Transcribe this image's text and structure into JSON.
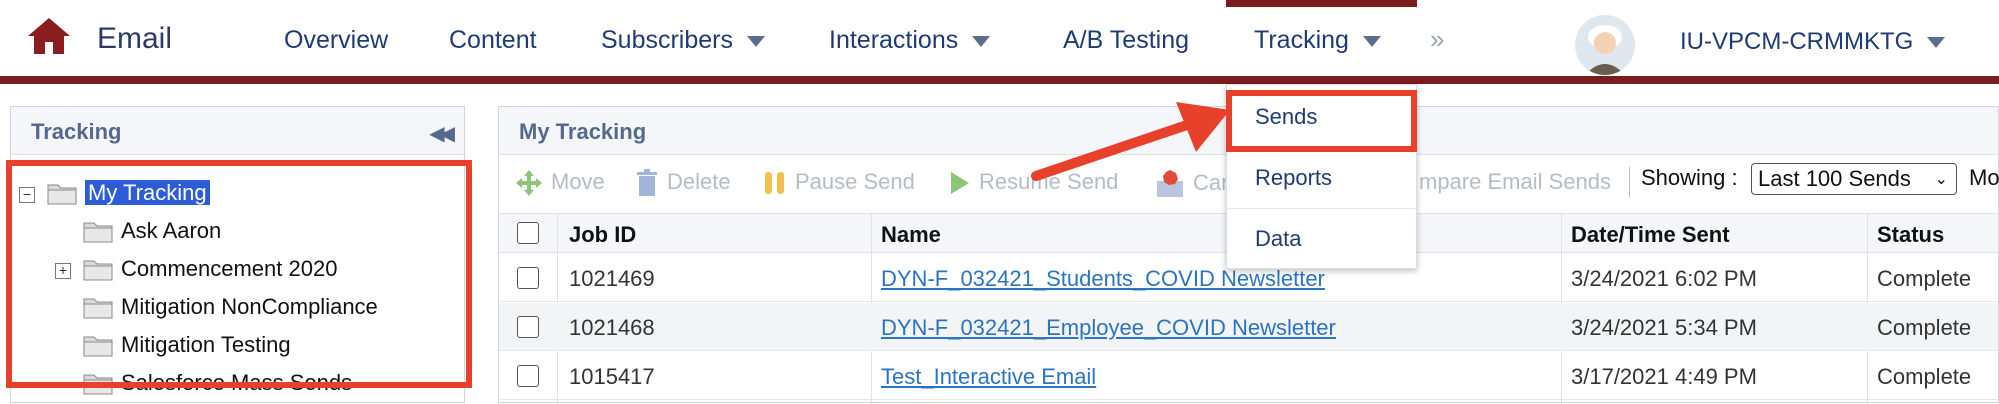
{
  "header": {
    "app_title": "Email",
    "nav": [
      "Overview",
      "Content",
      "Subscribers",
      "Interactions",
      "A/B Testing",
      "Tracking"
    ],
    "more": "»",
    "user": "IU-VPCM-CRMMKTG"
  },
  "dropdown": {
    "items": [
      "Sends",
      "Reports",
      "Data"
    ]
  },
  "left_panel": {
    "title": "Tracking",
    "tree": {
      "root": "My Tracking",
      "children": [
        "Ask Aaron",
        "Commencement 2020",
        "Mitigation NonCompliance",
        "Mitigation Testing",
        "Salesforce Mass Sends"
      ]
    }
  },
  "main_panel": {
    "title": "My Tracking",
    "toolbar": {
      "move": "Move",
      "delete": "Delete",
      "pause": "Pause Send",
      "resume": "Resume Send",
      "cancel": "Car",
      "compare": "mpare Email Sends",
      "showing_label": "Showing :",
      "showing_value": "Last 100 Sends",
      "more": "Mo"
    },
    "columns": [
      "Job ID",
      "Name",
      "Date/Time Sent",
      "Status"
    ],
    "rows": [
      {
        "job_id": "1021469",
        "name": "DYN-F_032421_Students_COVID Newsletter",
        "date": "3/24/2021 6:02 PM",
        "status": "Complete"
      },
      {
        "job_id": "1021468",
        "name": "DYN-F_032421_Employee_COVID Newsletter",
        "date": "3/24/2021 5:34 PM",
        "status": "Complete"
      },
      {
        "job_id": "1015417",
        "name": "Test_Interactive Email",
        "date": "3/17/2021 4:49 PM",
        "status": "Complete"
      }
    ]
  },
  "colors": {
    "brand": "#7b1c1c",
    "highlight": "#e8412b",
    "link": "#2a74c2"
  }
}
